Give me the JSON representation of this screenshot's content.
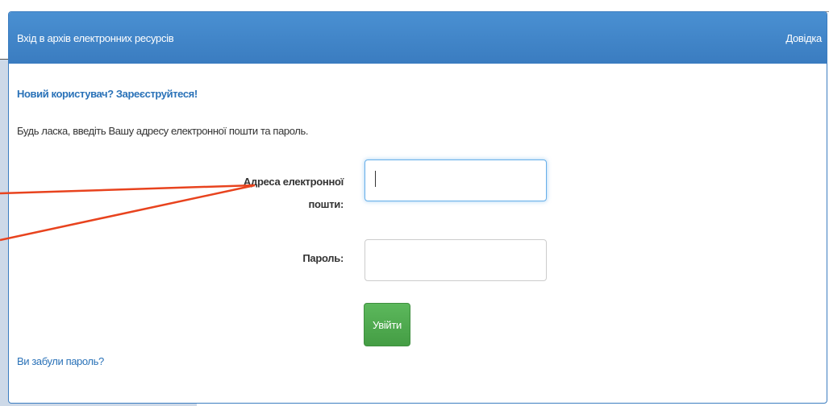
{
  "header": {
    "title": "Вхід в архів електронних ресурсів",
    "help_label": "Довідка"
  },
  "form": {
    "register_link": "Новий користувач? Зареєструйтеся!",
    "instructions": "Будь ласка, введіть Вашу адресу електронної пошти та пароль.",
    "email_label_line1": "Адреса електронної",
    "email_label_line2": "пошти:",
    "email_value": "",
    "password_label": "Пароль:",
    "password_value": "",
    "login_button": "Увійти",
    "forgot_link": "Ви забули пароль?"
  },
  "colors": {
    "header_blue": "#3a7cc0",
    "link_blue": "#2a72b8",
    "button_green": "#5cb85c",
    "annotation_red": "#e8431e",
    "slide_background": "#cdd9e8"
  }
}
